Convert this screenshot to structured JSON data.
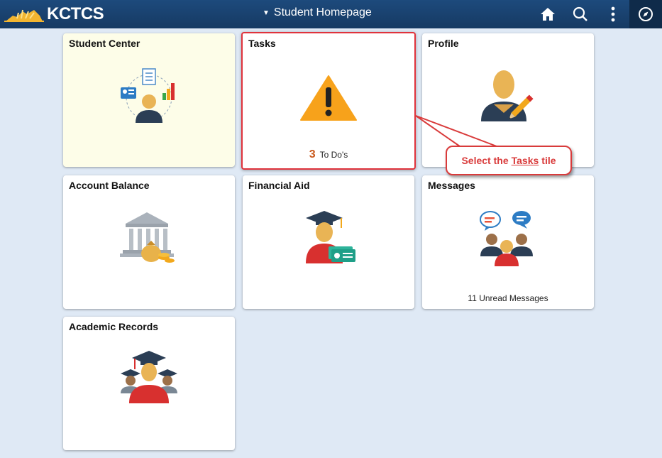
{
  "header": {
    "logo_text": "KCTCS",
    "homepage_title": "Student Homepage",
    "icons": [
      "home-icon",
      "search-icon",
      "more-actions-icon",
      "navbar-icon"
    ]
  },
  "tiles": {
    "student_center": {
      "title": "Student Center",
      "icon": "student-center-icon"
    },
    "tasks": {
      "title": "Tasks",
      "icon": "warning-triangle-icon",
      "count": "3",
      "count_label": "To Do's"
    },
    "profile": {
      "title": "Profile",
      "icon": "profile-pencil-icon"
    },
    "account_balance": {
      "title": "Account Balance",
      "icon": "bank-money-icon"
    },
    "financial_aid": {
      "title": "Financial Aid",
      "icon": "graduate-money-icon"
    },
    "messages": {
      "title": "Messages",
      "icon": "chat-people-icon",
      "footer": "11 Unread Messages"
    },
    "academic_records": {
      "title": "Academic Records",
      "icon": "graduates-icon"
    }
  },
  "callout": {
    "prefix": "Select the",
    "link": "Tasks",
    "suffix": "tile"
  },
  "colors": {
    "header_bg": "#1d4a7c",
    "page_bg": "#dfe9f5",
    "highlight": "#e0333c",
    "accent_orange": "#f7a21b"
  }
}
